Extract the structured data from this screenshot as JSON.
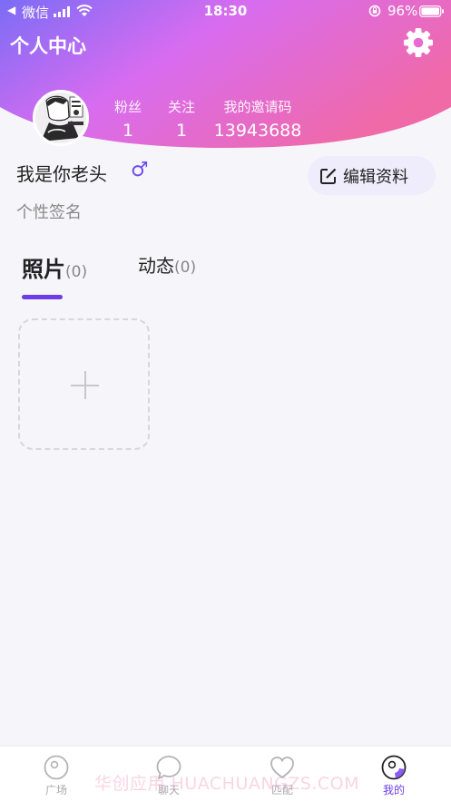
{
  "status_bar": {
    "back_arrow": "◀",
    "carrier": "微信",
    "time": "18:30",
    "battery": "96%"
  },
  "header": {
    "title": "个人中心",
    "settings_icon": "gear-icon",
    "gradient_colors": [
      "#7b6cf6",
      "#d86cf0",
      "#f06aa8"
    ]
  },
  "profile": {
    "stats": [
      {
        "label": "粉丝",
        "value": "1"
      },
      {
        "label": "关注",
        "value": "1"
      },
      {
        "label": "我的邀请码",
        "value": "13943688"
      }
    ],
    "nickname": "我是你老头",
    "gender_symbol": "♂",
    "edit_label": "编辑资料",
    "signature": "个性签名"
  },
  "tabs": [
    {
      "label": "照片",
      "count": "(0)",
      "active": true
    },
    {
      "label": "动态",
      "count": "(0)",
      "active": false
    }
  ],
  "accent_color": "#6d3de8",
  "bottom_nav": [
    {
      "label": "广场",
      "icon": "face-outline-icon",
      "active": false
    },
    {
      "label": "聊天",
      "icon": "chat-bubble-icon",
      "active": false
    },
    {
      "label": "匹配",
      "icon": "heart-icon",
      "active": false
    },
    {
      "label": "我的",
      "icon": "face-filled-icon",
      "active": true
    }
  ],
  "watermark": "华创应用 HUACHUANGZS.COM"
}
